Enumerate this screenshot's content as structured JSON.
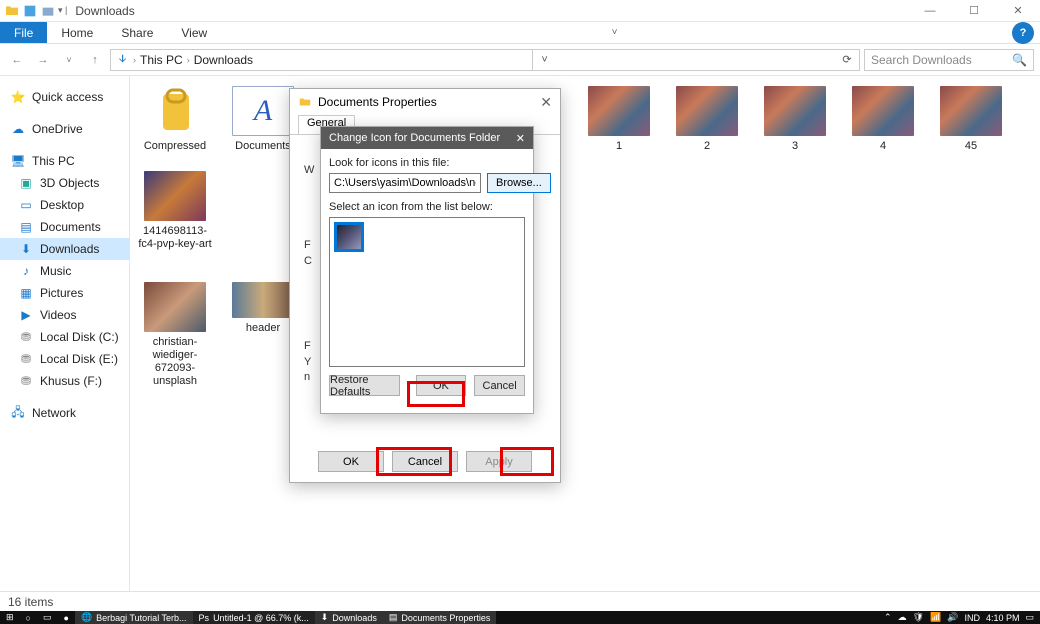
{
  "window": {
    "title": "Downloads"
  },
  "ribbon": {
    "file": "File",
    "home": "Home",
    "share": "Share",
    "view": "View"
  },
  "breadcrumb": {
    "pc": "This PC",
    "folder": "Downloads"
  },
  "search": {
    "placeholder": "Search Downloads"
  },
  "nav": {
    "quickaccess": "Quick access",
    "onedrive": "OneDrive",
    "thispc": "This PC",
    "objects3d": "3D Objects",
    "desktop": "Desktop",
    "documents": "Documents",
    "downloads": "Downloads",
    "music": "Music",
    "pictures": "Pictures",
    "videos": "Videos",
    "localc": "Local Disk (C:)",
    "locale": "Local Disk (E:)",
    "khusus": "Khusus  (F:)",
    "network": "Network"
  },
  "files": {
    "compressed": "Compressed",
    "documents": "Documents",
    "n1": "1",
    "n2": "2",
    "n3": "3",
    "n4": "4",
    "n45": "45",
    "keyart": "1414698113-fc4-pvp-key-art",
    "christian": "christian-wiediger-672093-unsplash",
    "header": "header"
  },
  "status": {
    "count": "16 items"
  },
  "propsDialog": {
    "title": "Documents Properties",
    "tab_general": "General",
    "w": "W",
    "c": "C",
    "f": "F",
    "y": "Y",
    "n": "n",
    "ok": "OK",
    "cancel": "Cancel",
    "apply": "Apply"
  },
  "changeDialog": {
    "title": "Change Icon for Documents Folder",
    "look_label": "Look for icons in this file:",
    "path": "C:\\Users\\yasim\\Downloads\\noragami",
    "browse": "Browse...",
    "select_label": "Select an icon from the list below:",
    "restore": "Restore Defaults",
    "ok": "OK",
    "cancel": "Cancel"
  },
  "taskbar": {
    "berbagi": "Berbagi Tutorial Terb...",
    "untitled": "Untitled-1 @ 66.7% (k...",
    "downloads": "Downloads",
    "docprops": "Documents Properties",
    "lang": "IND",
    "time": "4:10 PM"
  }
}
